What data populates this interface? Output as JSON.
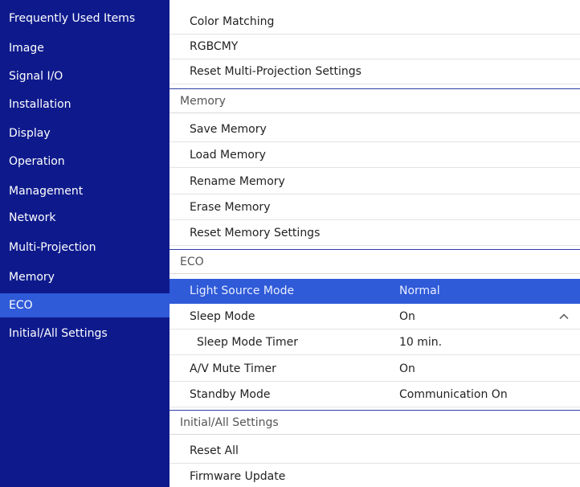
{
  "sidebar": {
    "items": [
      {
        "label": "Frequently Used Items"
      },
      {
        "label": "Image"
      },
      {
        "label": "Signal I/O"
      },
      {
        "label": "Installation"
      },
      {
        "label": "Display"
      },
      {
        "label": "Operation"
      },
      {
        "label": "Management"
      },
      {
        "label": "Network"
      },
      {
        "label": "Multi-Projection"
      },
      {
        "label": "Memory"
      },
      {
        "label": "ECO"
      },
      {
        "label": "Initial/All Settings"
      }
    ],
    "selected_item": "ECO"
  },
  "main": {
    "multi_projection": {
      "items": [
        {
          "label": "Color Matching"
        },
        {
          "label": "RGBCMY"
        },
        {
          "label": "Reset Multi-Projection Settings"
        }
      ]
    },
    "memory": {
      "header": "Memory",
      "items": [
        {
          "label": "Save Memory"
        },
        {
          "label": "Load Memory"
        },
        {
          "label": "Rename Memory"
        },
        {
          "label": "Erase Memory"
        },
        {
          "label": "Reset Memory Settings"
        }
      ]
    },
    "eco": {
      "header": "ECO",
      "items": [
        {
          "label": "Light Source Mode",
          "value": "Normal"
        },
        {
          "label": "Sleep Mode",
          "value": "On"
        },
        {
          "label": "Sleep Mode Timer",
          "value": "10 min."
        },
        {
          "label": "A/V Mute Timer",
          "value": "On"
        },
        {
          "label": "Standby Mode",
          "value": "Communication On"
        }
      ],
      "selected_item": "Light Source Mode",
      "expanded_icon": "chevron-up-icon"
    },
    "initial_all": {
      "header": "Initial/All Settings",
      "items": [
        {
          "label": "Reset All"
        },
        {
          "label": "Firmware Update"
        }
      ]
    }
  },
  "colors": {
    "sidebar_bg": "#0e1a8c",
    "highlight": "#2f5ad8",
    "text": "#222222",
    "header_text": "#555555"
  }
}
